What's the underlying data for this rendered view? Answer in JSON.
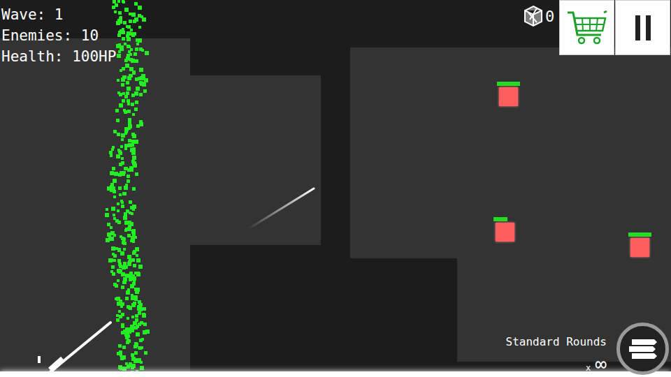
{
  "hud": {
    "wave": "Wave: 1",
    "enemies": "Enemies: 10",
    "health": "Health: 100HP"
  },
  "currency": {
    "amount": "0"
  },
  "enemies": [
    {
      "level": 1.0
    },
    {
      "level": 0.6
    },
    {
      "level": 1.0
    }
  ],
  "ammo": {
    "name": "Standard Rounds",
    "prefix": "x",
    "count": "∞"
  }
}
